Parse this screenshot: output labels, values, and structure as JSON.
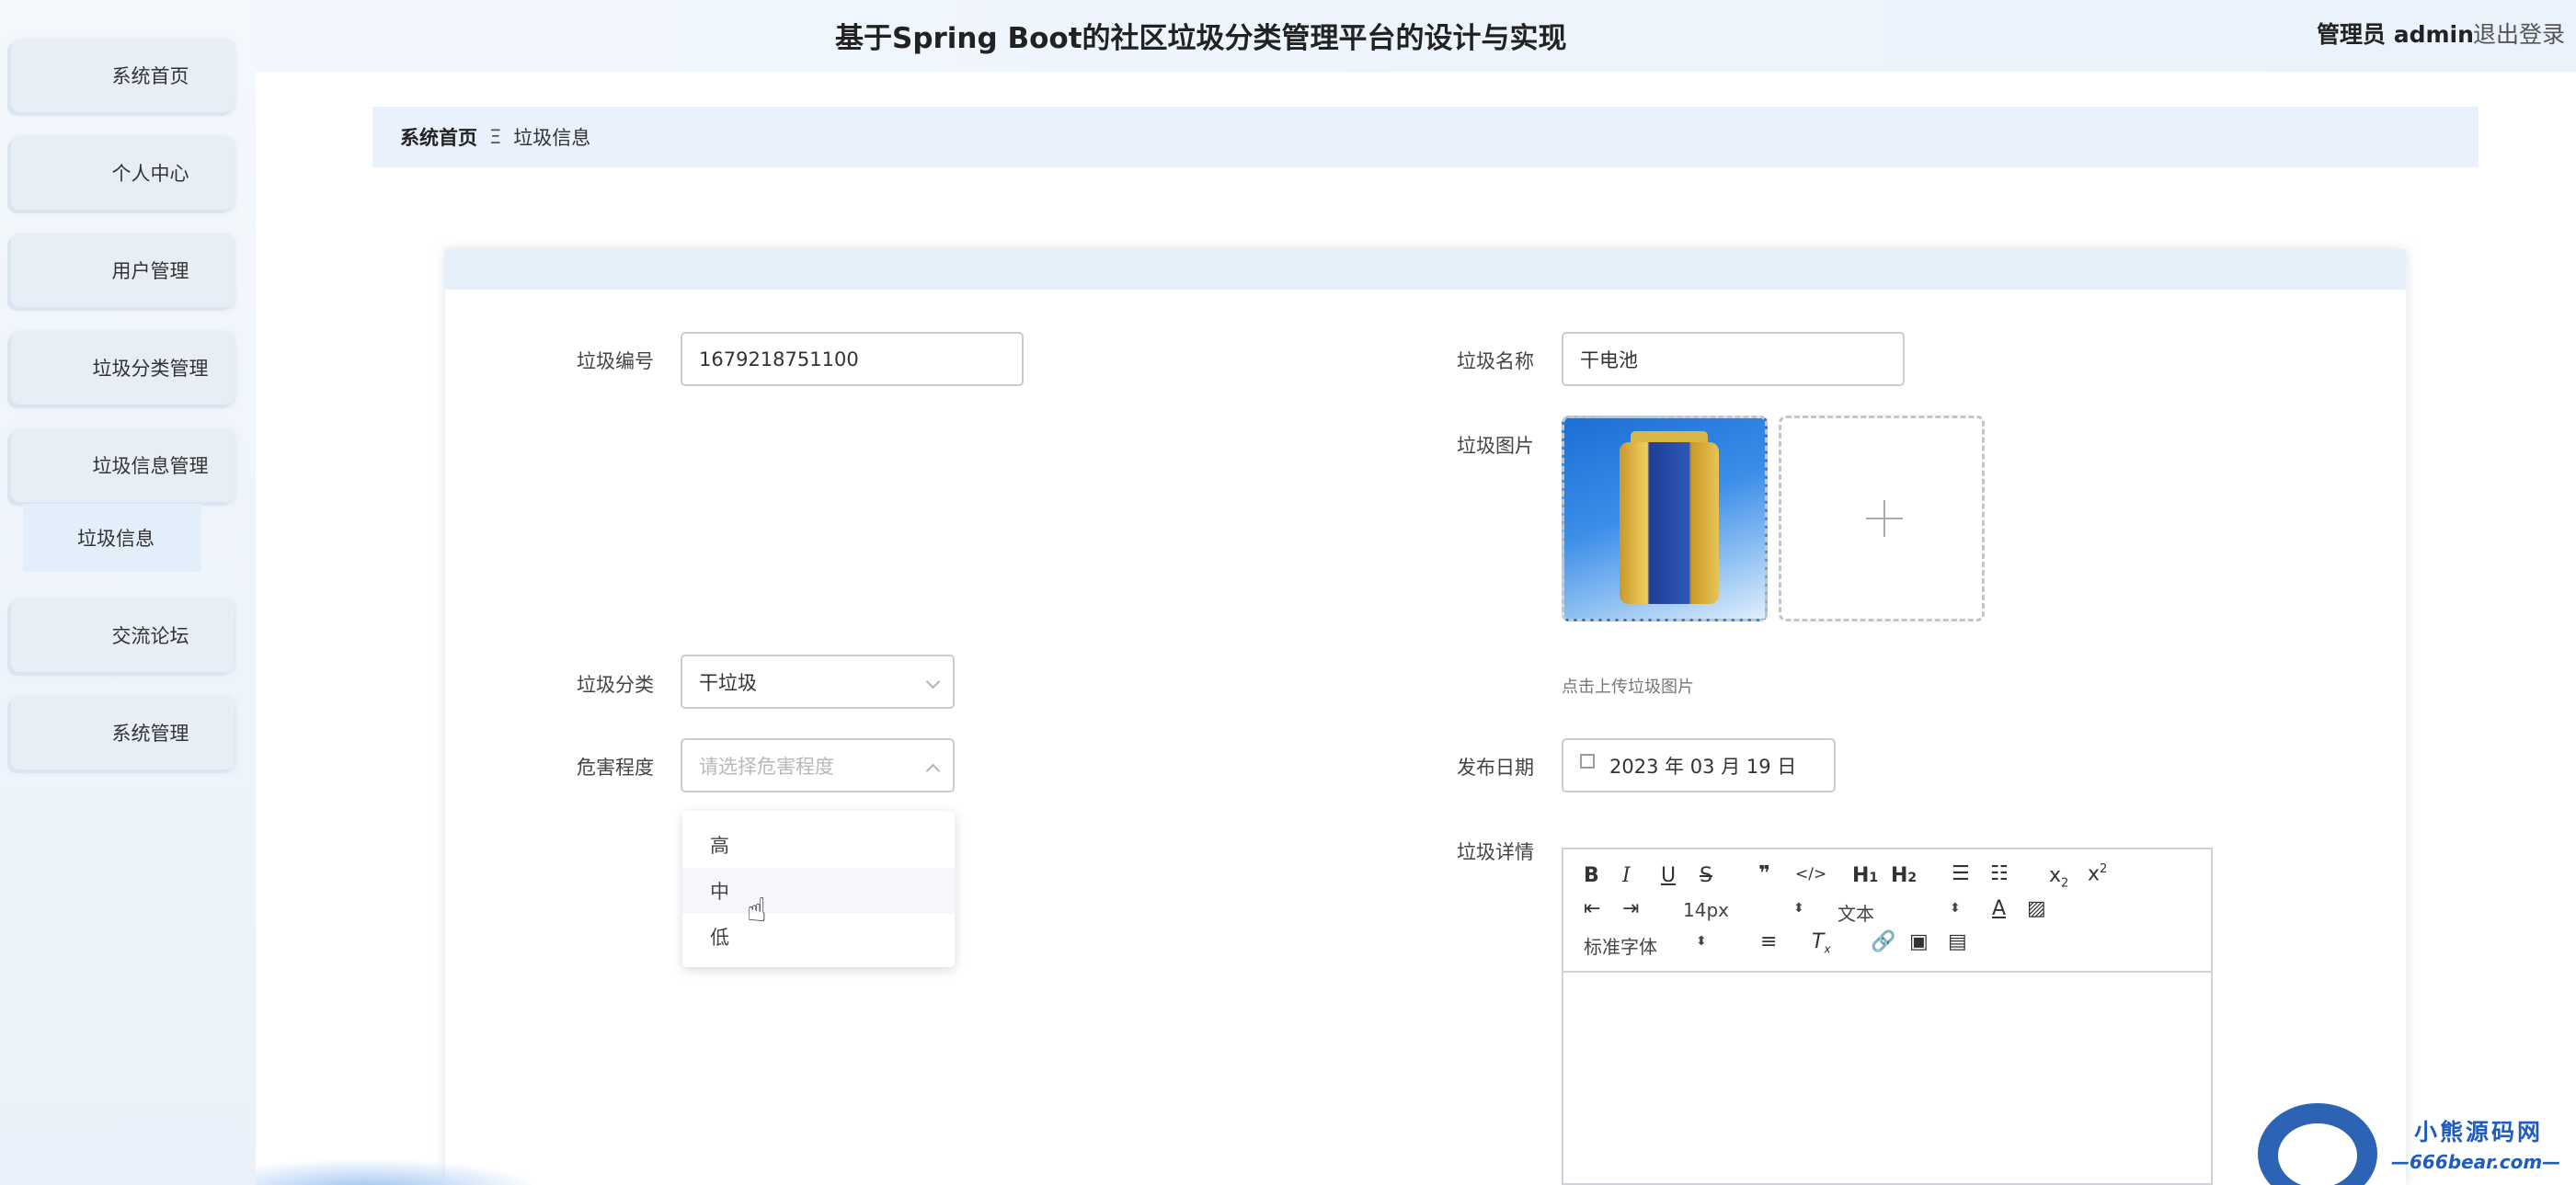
{
  "header": {
    "title": "基于Spring Boot的社区垃圾分类管理平台的设计与实现",
    "user": "管理员 admin",
    "logout": "退出登录"
  },
  "sidebar": {
    "items": [
      "系统首页",
      "个人中心",
      "用户管理",
      "垃圾分类管理",
      "垃圾信息管理",
      "交流论坛",
      "系统管理"
    ],
    "active_sub": "垃圾信息"
  },
  "breadcrumb": {
    "home": "系统首页",
    "separator": "Ξ",
    "current": "垃圾信息"
  },
  "form": {
    "code_label": "垃圾编号",
    "code_value": "1679218751100",
    "name_label": "垃圾名称",
    "name_value": "干电池",
    "image_label": "垃圾图片",
    "image_tip": "点击上传垃圾图片",
    "category_label": "垃圾分类",
    "category_value": "干垃圾",
    "hazard_label": "危害程度",
    "hazard_placeholder": "请选择危害程度",
    "hazard_options": [
      "高",
      "中",
      "低"
    ],
    "date_label": "发布日期",
    "date_value": "2023 年 03 月 19 日",
    "detail_label": "垃圾详情"
  },
  "editor": {
    "font_size": "14px",
    "paragraph": "文本",
    "font_family": "标准字体"
  },
  "watermark": {
    "brand": "小熊源码网",
    "domain": "—666bear.com—"
  }
}
